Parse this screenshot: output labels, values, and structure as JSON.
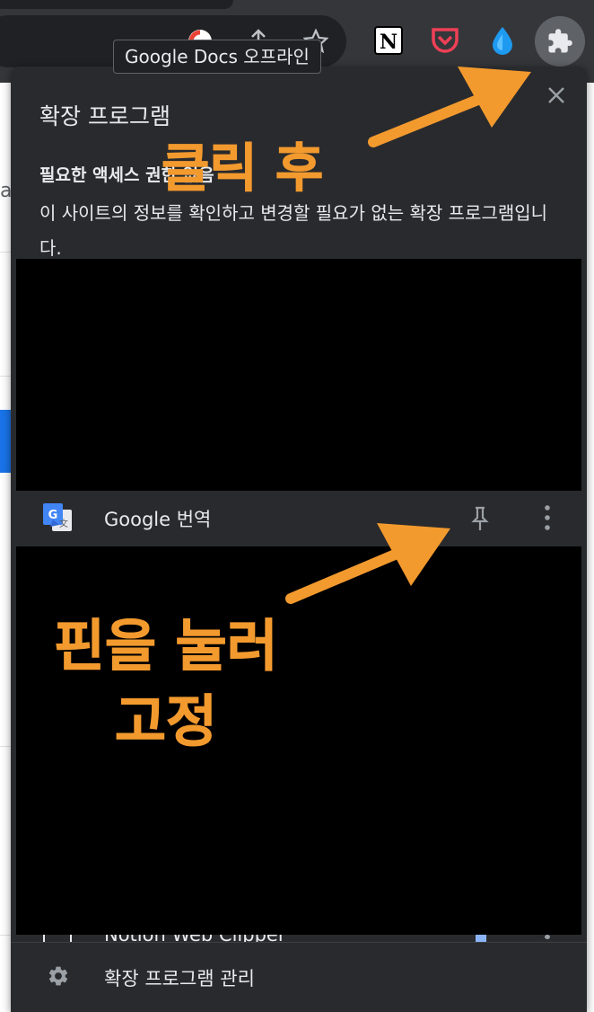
{
  "browser": {
    "tooltip": "Google Docs 오프라인",
    "toolbar_icons": [
      "google-docs-offline-icon",
      "share-icon",
      "bookmark-star-icon"
    ],
    "extension_icons": [
      "notion-icon",
      "pocket-icon",
      "raindrop-icon",
      "extensions-puzzle-icon"
    ],
    "notion_letter": "N",
    "page_letter": "a"
  },
  "popup": {
    "title": "확장 프로그램",
    "section_heading": "필요한 액세스 권한 없음",
    "section_description": "이 사이트의 정보를 확인하고 변경할 필요가 없는 확장 프로그램입니다.",
    "extensions": [
      {
        "name": "Google 번역",
        "icon": "google-translate-icon",
        "pinned": false
      },
      {
        "name": "Notion Web Clipper",
        "icon": "notion-web-clipper-icon",
        "pinned": true
      }
    ],
    "footer_label": "확장 프로그램 관리"
  },
  "annotations": {
    "click_after": "클릭 후",
    "pin_line1": "핀을 눌러",
    "pin_line2": "고정",
    "color": "#f39a2e"
  },
  "colors": {
    "popup_bg": "#292a2d",
    "toolbar_bg": "#35363a",
    "text": "#e8eaed",
    "accent_blue": "#1a73e8"
  }
}
